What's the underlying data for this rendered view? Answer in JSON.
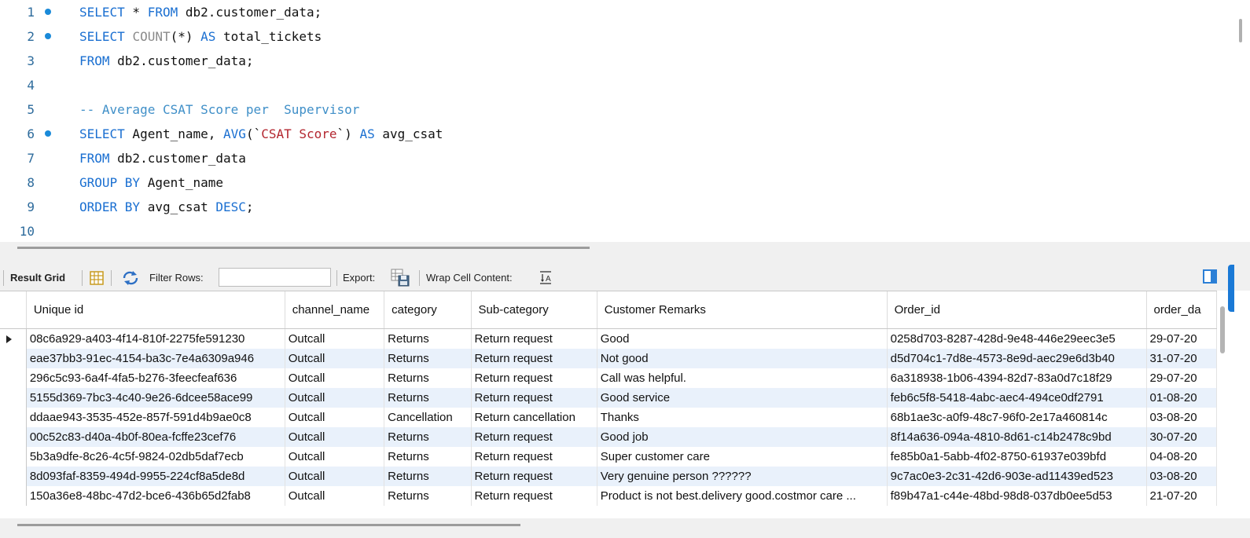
{
  "editor": {
    "lines": [
      {
        "n": "1",
        "marker": true,
        "html": "<span class='kw'>SELECT</span> * <span class='kw'>FROM</span> db2.customer_data;"
      },
      {
        "n": "2",
        "marker": true,
        "html": "<span class='kw'>SELECT</span> <span class='fn'>COUNT</span>(*) <span class='kw'>AS</span> total_tickets"
      },
      {
        "n": "3",
        "marker": false,
        "html": "<span class='kw'>FROM</span> db2.customer_data;"
      },
      {
        "n": "4",
        "marker": false,
        "html": ""
      },
      {
        "n": "5",
        "marker": false,
        "html": "<span class='cm'>-- Average CSAT Score per  Supervisor</span>"
      },
      {
        "n": "6",
        "marker": true,
        "html": "<span class='kw'>SELECT</span> Agent_name, <span class='kw'>AVG</span>(`<span class='str'>CSAT Score</span>`) <span class='kw'>AS</span> avg_csat"
      },
      {
        "n": "7",
        "marker": false,
        "html": "<span class='kw'>FROM</span> db2.customer_data"
      },
      {
        "n": "8",
        "marker": false,
        "html": "<span class='kw'>GROUP BY</span> Agent_name"
      },
      {
        "n": "9",
        "marker": false,
        "html": "<span class='kw'>ORDER BY</span> avg_csat <span class='kw'>DESC</span>;"
      },
      {
        "n": "10",
        "marker": false,
        "html": ""
      }
    ]
  },
  "toolbar": {
    "result_grid_label": "Result Grid",
    "filter_rows_label": "Filter Rows:",
    "filter_value": "",
    "export_label": "Export:",
    "wrap_label": "Wrap Cell Content:"
  },
  "grid": {
    "columns": [
      "Unique id",
      "channel_name",
      "category",
      "Sub-category",
      "Customer Remarks",
      "Order_id",
      "order_da"
    ],
    "rows": [
      [
        "08c6a929-a403-4f14-810f-2275fe591230",
        "Outcall",
        "Returns",
        "Return request",
        "Good",
        "0258d703-8287-428d-9e48-446e29eec3e5",
        "29-07-20"
      ],
      [
        "eae37bb3-91ec-4154-ba3c-7e4a6309a946",
        "Outcall",
        "Returns",
        "Return request",
        "Not good",
        "d5d704c1-7d8e-4573-8e9d-aec29e6d3b40",
        "31-07-20"
      ],
      [
        "296c5c93-6a4f-4fa5-b276-3feecfeaf636",
        "Outcall",
        "Returns",
        "Return request",
        "Call was helpful.",
        "6a318938-1b06-4394-82d7-83a0d7c18f29",
        "29-07-20"
      ],
      [
        "5155d369-7bc3-4c40-9e26-6dcee58ace99",
        "Outcall",
        "Returns",
        "Return request",
        "Good service",
        "feb6c5f8-5418-4abc-aec4-494ce0df2791",
        "01-08-20"
      ],
      [
        "ddaae943-3535-452e-857f-591d4b9ae0c8",
        "Outcall",
        "Cancellation",
        "Return cancellation",
        "Thanks",
        "68b1ae3c-a0f9-48c7-96f0-2e17a460814c",
        "03-08-20"
      ],
      [
        "00c52c83-d40a-4b0f-80ea-fcffe23cef76",
        "Outcall",
        "Returns",
        "Return request",
        "Good job",
        "8f14a636-094a-4810-8d61-c14b2478c9bd",
        "30-07-20"
      ],
      [
        "5b3a9dfe-8c26-4c5f-9824-02db5daf7ecb",
        "Outcall",
        "Returns",
        "Return request",
        "Super customer care",
        "fe85b0a1-5abb-4f02-8750-61937e039bfd",
        "04-08-20"
      ],
      [
        "8d093faf-8359-494d-9955-224cf8a5de8d",
        "Outcall",
        "Returns",
        "Return request",
        "Very genuine person ??????",
        "9c7ac0e3-2c31-42d6-903e-ad11439ed523",
        "03-08-20"
      ],
      [
        "150a36e8-48bc-47d2-bce6-436b65d2fab8",
        "Outcall",
        "Returns",
        "Return request",
        "Product is not best.delivery good.costmor care ...",
        "f89b47a1-c44e-48bd-98d8-037db0ee5d53",
        "21-07-20"
      ]
    ]
  }
}
